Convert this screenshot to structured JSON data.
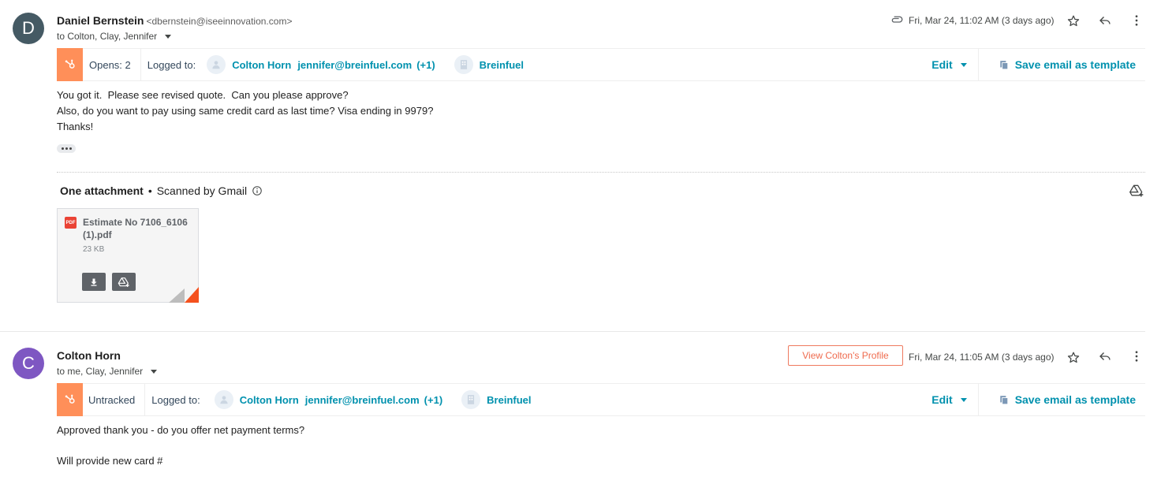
{
  "messages": [
    {
      "avatar_letter": "D",
      "avatar_color": "#455a64",
      "sender_name": "Daniel Bernstein",
      "sender_email": "<dbernstein@iseeinnovation.com>",
      "recipients": "to Colton, Clay, Jennifer",
      "date": "Fri, Mar 24, 11:02 AM (3 days ago)",
      "hubspot": {
        "tracking": "Opens: 2",
        "logged_to_label": "Logged to:",
        "contact_name": "Colton Horn",
        "contact_email": "jennifer@breinfuel.com",
        "more_count": "(+1)",
        "company": "Breinfuel",
        "edit_label": "Edit",
        "save_template_label": "Save email as template"
      },
      "body": [
        "You got it.  Please see revised quote.  Can you please approve?",
        "Also, do you want to pay using same credit card as last time? Visa ending in 9979?",
        "Thanks!"
      ],
      "attachments_title": "One attachment",
      "scanned_label": "Scanned by Gmail",
      "attachment": {
        "name": "Estimate No 7106_6106 (1).pdf",
        "size": "23 KB",
        "type_badge": "PDF"
      }
    },
    {
      "avatar_letter": "C",
      "avatar_color": "#7e57c2",
      "sender_name": "Colton Horn",
      "recipients": "to me, Clay, Jennifer",
      "date": "Fri, Mar 24, 11:05 AM (3 days ago)",
      "view_profile_label": "View Colton's Profile",
      "hubspot": {
        "tracking": "Untracked",
        "logged_to_label": "Logged to:",
        "contact_name": "Colton Horn",
        "contact_email": "jennifer@breinfuel.com",
        "more_count": "(+1)",
        "company": "Breinfuel",
        "edit_label": "Edit",
        "save_template_label": "Save email as template"
      },
      "body": [
        "Approved thank you - do you offer net payment terms?",
        "",
        "Will provide new card #"
      ]
    }
  ],
  "colors": {
    "hubspot_orange": "#ff8f59",
    "hubspot_link": "#0091ae",
    "profile_accent": "#ef6b4e",
    "pdf_red": "#ea4335"
  },
  "icons": [
    "attachment-icon",
    "star-icon",
    "reply-icon",
    "more-vert-icon",
    "hubspot-logo-icon",
    "contact-icon",
    "company-icon",
    "copy-icon",
    "info-icon",
    "add-to-drive-icon",
    "download-icon",
    "pdf-icon"
  ]
}
